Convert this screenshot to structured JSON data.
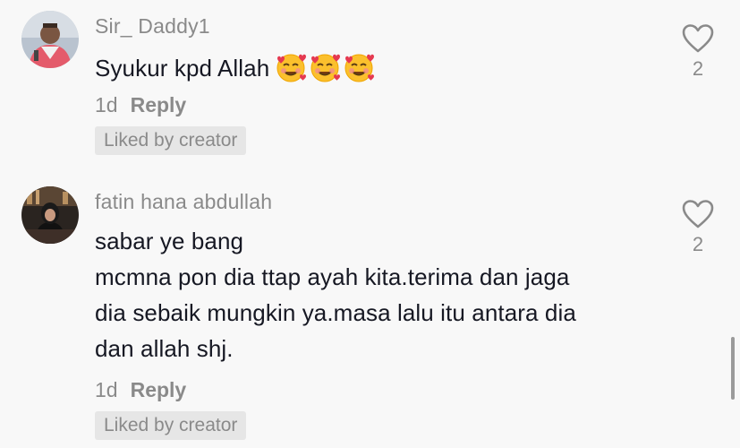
{
  "comments": [
    {
      "username": "Sir_ Daddy1",
      "text": "Syukur kpd Allah",
      "emoji": [
        "🥰",
        "🥰",
        "🥰"
      ],
      "time": "1d",
      "reply_label": "Reply",
      "badge": "Liked by creator",
      "likes": "2"
    },
    {
      "username": "fatin hana abdullah",
      "lines": [
        "sabar ye bang",
        "mcmna pon dia ttap ayah kita.terima dan jaga",
        "dia sebaik mungkin ya.masa lalu itu antara dia",
        "dan allah shj."
      ],
      "time": "1d",
      "reply_label": "Reply",
      "badge": "Liked by creator",
      "likes": "2"
    }
  ],
  "icons": {
    "like": "heart-outline-icon"
  },
  "colors": {
    "background": "#f8f8f8",
    "text": "#161823",
    "secondary": "#8a8a8a",
    "badge_bg": "#e6e6e6"
  }
}
